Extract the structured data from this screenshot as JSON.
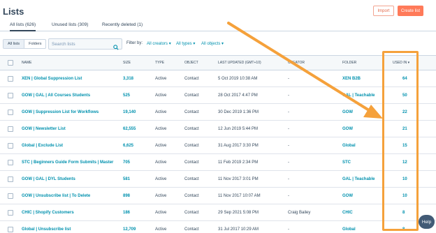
{
  "header": {
    "title": "Lists",
    "import_label": "Import",
    "create_label": "Create list"
  },
  "tabs": [
    {
      "label": "All lists (626)"
    },
    {
      "label": "Unused lists (309)"
    },
    {
      "label": "Recently deleted (1)"
    }
  ],
  "view_toggle": {
    "lists_label": "All lists",
    "folders_label": "Folders"
  },
  "search": {
    "placeholder": "Search lists",
    "value": ""
  },
  "filters": {
    "label": "Filter by:",
    "creators": "All creators",
    "types": "All types",
    "objects": "All objects"
  },
  "columns": {
    "name": "NAME",
    "size": "SIZE",
    "type": "TYPE",
    "object": "OBJECT",
    "last_updated": "LAST UPDATED (GMT+10)",
    "creator": "CREATOR",
    "folder": "FOLDER",
    "used_in": "USED IN"
  },
  "rows": [
    {
      "name": "XEN | Global Suppression List",
      "size": "3,318",
      "type": "Active",
      "object": "Contact",
      "updated": "5 Oct 2019 10:38 AM",
      "creator": "-",
      "folder": "XEN B2B",
      "used": "64"
    },
    {
      "name": "GOW | GAL | All Courses Students",
      "size": "525",
      "type": "Active",
      "object": "Contact",
      "updated": "28 Oct 2017 4:47 PM",
      "creator": "-",
      "folder": "GAL | Teachable",
      "used": "50"
    },
    {
      "name": "GOW | Suppression List for Workflows",
      "size": "19,140",
      "type": "Active",
      "object": "Contact",
      "updated": "30 Dec 2019 1:36 PM",
      "creator": "-",
      "folder": "GOW",
      "used": "22"
    },
    {
      "name": "GOW | Newsletter List",
      "size": "62,555",
      "type": "Active",
      "object": "Contact",
      "updated": "12 Jun 2019 5:44 PM",
      "creator": "-",
      "folder": "GOW",
      "used": "21"
    },
    {
      "name": "Global | Exclude List",
      "size": "6,625",
      "type": "Active",
      "object": "Contact",
      "updated": "31 Aug 2017 3:30 PM",
      "creator": "-",
      "folder": "Global",
      "used": "15"
    },
    {
      "name": "STC | Beginners Guide Form Submits | Master",
      "size": "705",
      "type": "Active",
      "object": "Contact",
      "updated": "11 Feb 2019 2:34 PM",
      "creator": "-",
      "folder": "STC",
      "used": "12"
    },
    {
      "name": "GOW | GAL | DYL Students",
      "size": "581",
      "type": "Active",
      "object": "Contact",
      "updated": "11 Nov 2017 3:01 PM",
      "creator": "-",
      "folder": "GAL | Teachable",
      "used": "10"
    },
    {
      "name": "GOW | Unsubscribe list | To Delete",
      "size": "898",
      "type": "Active",
      "object": "Contact",
      "updated": "11 Nov 2017 10:07 AM",
      "creator": "-",
      "folder": "GOW",
      "used": "10"
    },
    {
      "name": "CHIC | Shopify Customers",
      "size": "186",
      "type": "Active",
      "object": "Contact",
      "updated": "29 Sep 2021 5:08 PM",
      "creator": "Craig Bailey",
      "folder": "CHIC",
      "used": "8"
    },
    {
      "name": "Global | Unsubscribe list",
      "size": "12,709",
      "type": "Active",
      "object": "Contact",
      "updated": "31 Jul 2017 10:29 AM",
      "creator": "-",
      "folder": "Global",
      "used": "8"
    }
  ],
  "help": {
    "label": "Help"
  },
  "colors": {
    "accent": "#0091ae",
    "primary_button": "#ff7a59",
    "annotation": "#f5a13b"
  },
  "icons": {
    "search": "search-icon",
    "sort": "sort-down-icon",
    "dropdown": "chevron-down-icon"
  }
}
